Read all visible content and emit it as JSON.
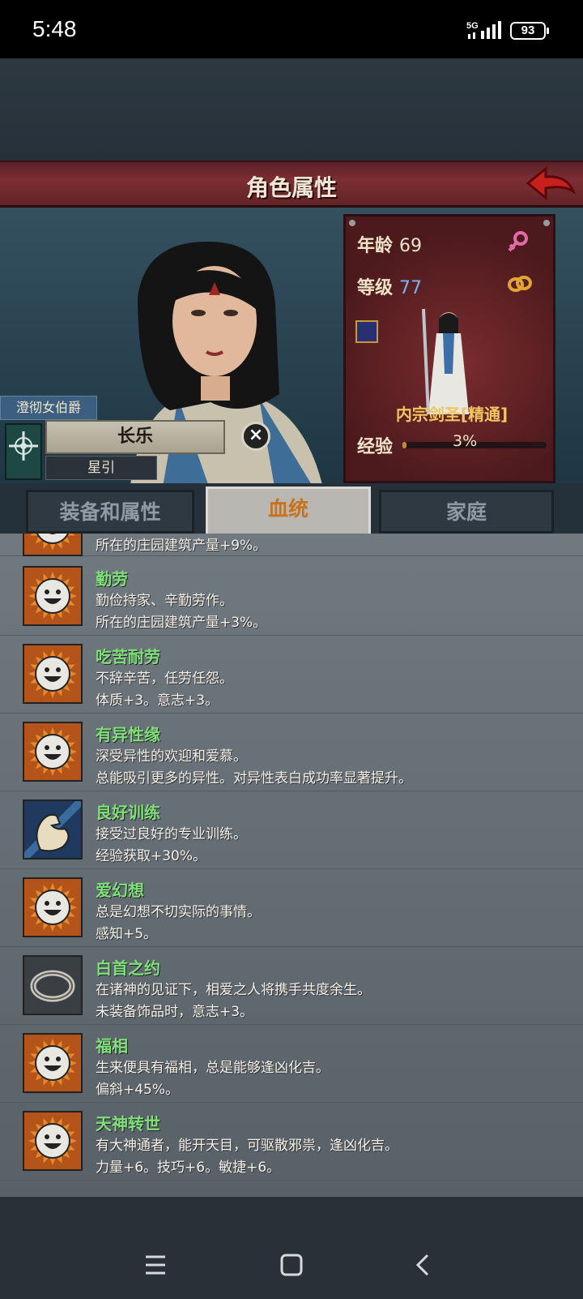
{
  "status": {
    "time": "5:48",
    "network": "5G",
    "battery": "93"
  },
  "header": {
    "title": "角色属性"
  },
  "character": {
    "rank": "澄彻女伯爵",
    "name": "长乐",
    "sub": "星引",
    "age_label": "年龄",
    "age": "69",
    "level_label": "等级",
    "level": "77",
    "class": "内宗剑圣[精通]",
    "exp_label": "经验",
    "exp": "3%",
    "exp_fraction": 0.03
  },
  "tabs": [
    {
      "label": "装备和属性",
      "active": false
    },
    {
      "label": "血统",
      "active": true
    },
    {
      "label": "家庭",
      "active": false
    }
  ],
  "partial_trait": {
    "line2": "所在的庄园建筑产量+9%。"
  },
  "traits": [
    {
      "name": "勤劳",
      "line1": "勤俭持家、辛勤劳作。",
      "line2": "所在的庄园建筑产量+3%。",
      "icon": "smiley-sun-icon"
    },
    {
      "name": "吃苦耐劳",
      "line1": "不辞辛苦，任劳任怨。",
      "line2": "体质+3。意志+3。",
      "icon": "smiley-sun-icon"
    },
    {
      "name": "有异性缘",
      "line1": "深受异性的欢迎和爱慕。",
      "line2": "总能吸引更多的异性。对异性表白成功率显著提升。",
      "icon": "smiley-sun-icon"
    },
    {
      "name": "良好训练",
      "line1": "接受过良好的专业训练。",
      "line2": "经验获取+30%。",
      "icon": "flexed-arm-icon"
    },
    {
      "name": "爱幻想",
      "line1": "总是幻想不切实际的事情。",
      "line2": "感知+5。",
      "icon": "smiley-sun-icon"
    },
    {
      "name": "白首之约",
      "line1": "在诸神的见证下，相爱之人将携手共度余生。",
      "line2": "未装备饰品时，意志+3。",
      "icon": "ring-icon"
    },
    {
      "name": "福相",
      "line1": "生来便具有福相，总是能够逢凶化吉。",
      "line2": "偏斜+45%。",
      "icon": "smiley-sun-icon"
    },
    {
      "name": "天神转世",
      "line1": "有大神通者，能开天目，可驱散邪祟，逢凶化吉。",
      "line2": "力量+6。技巧+6。敏捷+6。",
      "icon": "smiley-sun-icon"
    }
  ],
  "colors": {
    "accent": "#c9721b",
    "trait_name": "#7fe07a",
    "title_bar": "#7b2e33"
  }
}
